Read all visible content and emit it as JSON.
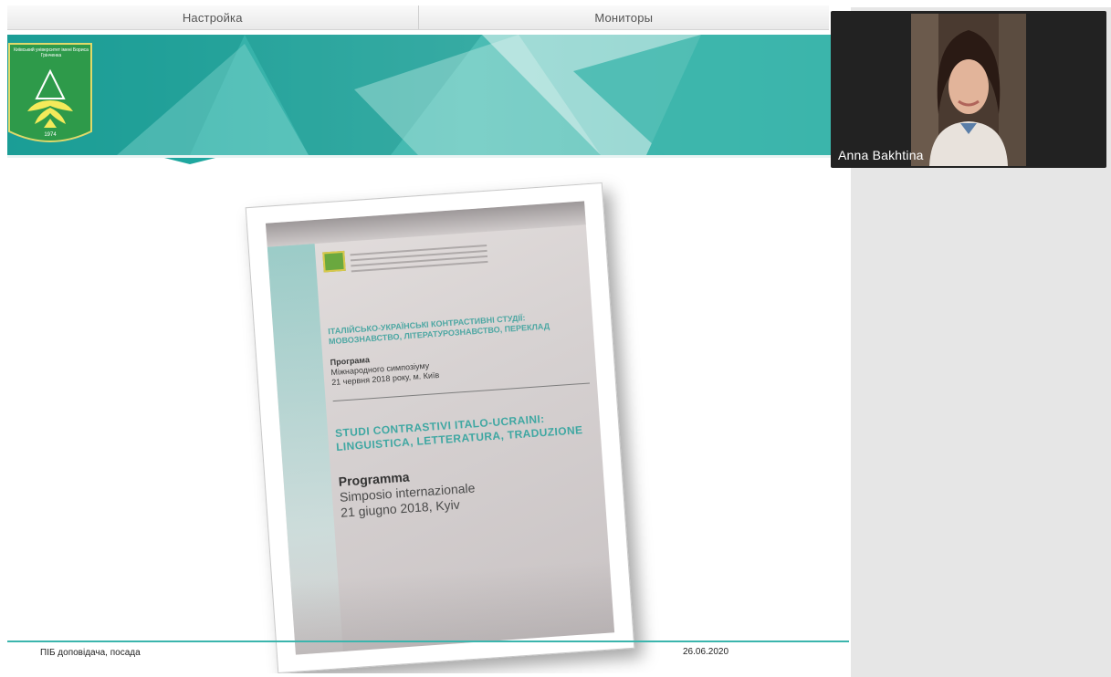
{
  "toolbar": {
    "tab_settings": "Настройка",
    "tab_monitors": "Мониторы"
  },
  "slide": {
    "logo": {
      "university_name": "Київський університет імені Бориса Грінченка",
      "year": "1974"
    },
    "programme_photo": {
      "ua_title": "Італійсько-українські контрастивні студії: мовознавство, літературознавство, переклад",
      "ua_programme_heading": "Програма",
      "ua_programme_line1": "Міжнародного симпозіуму",
      "ua_programme_line2": "21 червня 2018 року, м. Київ",
      "it_title": "Studi contrastivi italo-ucraini: linguistica, letteratura, traduzione",
      "it_programme_heading": "Programma",
      "it_programme_line1": "Simposio internazionale",
      "it_programme_line2": "21 giugno 2018, Kyiv"
    },
    "footer_left": "ПІБ доповідача, посада",
    "footer_date": "26.06.2020"
  },
  "participant": {
    "name": "Anna Bakhtina"
  },
  "colors": {
    "teal_accent": "#3bb5ad",
    "logo_green": "#2e9a4a",
    "panel_grey": "#e6e6e6",
    "video_bg": "#222222"
  },
  "icons": {
    "logo": "university-crest-icon"
  }
}
